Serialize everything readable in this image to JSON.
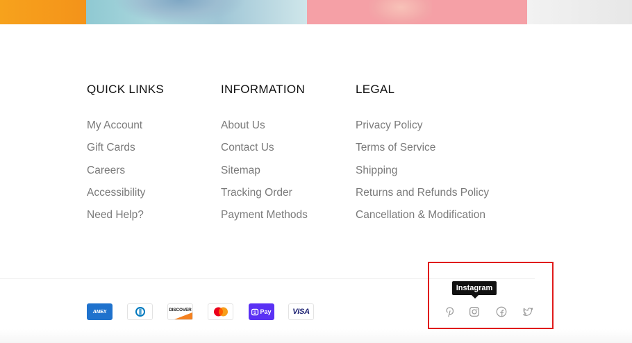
{
  "footer": {
    "columns": [
      {
        "title": "QUICK LINKS",
        "links": [
          "My Account",
          "Gift Cards",
          "Careers",
          "Accessibility",
          "Need Help?"
        ]
      },
      {
        "title": "INFORMATION",
        "links": [
          "About Us",
          "Contact Us",
          "Sitemap",
          "Tracking Order",
          "Payment Methods"
        ]
      },
      {
        "title": "LEGAL",
        "links": [
          "Privacy Policy",
          "Terms of Service",
          "Shipping",
          "Returns and Refunds Policy",
          "Cancellation & Modification"
        ]
      }
    ],
    "payments": {
      "amex": "AMEX",
      "discover": "DISCOVER",
      "shop_pay": "Pay",
      "visa": "VISA"
    },
    "social": {
      "tooltip": "Instagram",
      "icons": [
        "pinterest-icon",
        "instagram-icon",
        "facebook-icon",
        "twitter-icon"
      ]
    },
    "colors": {
      "highlight": "#e01a1a",
      "link": "#7a7a7a",
      "heading": "#111111",
      "icon": "#9a9a9a"
    }
  }
}
